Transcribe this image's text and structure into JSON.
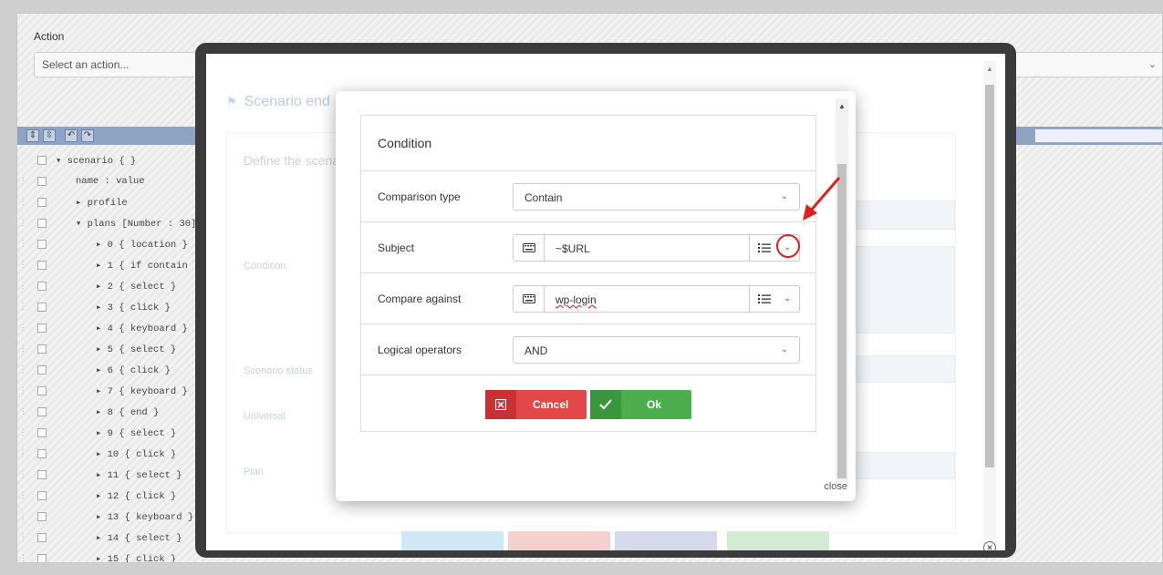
{
  "background": {
    "action_label": "Action",
    "action_placeholder": "Select an action...",
    "tree": [
      {
        "text": "▾ scenario { }",
        "indent": 0
      },
      {
        "text": "name : value",
        "indent": 1
      },
      {
        "text": "▸ profile",
        "indent": 1
      },
      {
        "text": "▾ plans [Number : 30]",
        "indent": 1
      },
      {
        "text": "▸ 0  { location }",
        "indent": 2
      },
      {
        "text": "▸ 1  { if contain",
        "indent": 2
      },
      {
        "text": "▸ 2  { select }",
        "indent": 2
      },
      {
        "text": "▸ 3  { click }",
        "indent": 2
      },
      {
        "text": "▸ 4  { keyboard }",
        "indent": 2
      },
      {
        "text": "▸ 5  { select }",
        "indent": 2
      },
      {
        "text": "▸ 6  { click }",
        "indent": 2
      },
      {
        "text": "▸ 7  { keyboard }",
        "indent": 2
      },
      {
        "text": "▸ 8  { end }",
        "indent": 2
      },
      {
        "text": "▸ 9  { select }",
        "indent": 2
      },
      {
        "text": "▸ 10 { click }",
        "indent": 2
      },
      {
        "text": "▸ 11 { select }",
        "indent": 2
      },
      {
        "text": "▸ 12 { click }",
        "indent": 2
      },
      {
        "text": "▸ 13 { keyboard }",
        "indent": 2
      },
      {
        "text": "▸ 14 { select }",
        "indent": 2
      },
      {
        "text": "▸ 15 { click }",
        "indent": 2
      }
    ]
  },
  "modal": {
    "title": "Scenario end",
    "define_title": "Define the scena",
    "labels": {
      "condition": "Condition",
      "scenario_status": "Scenario status",
      "universal": "Universal",
      "plan": "Plan"
    }
  },
  "dialog": {
    "title": "Condition",
    "rows": {
      "comparison_type": {
        "label": "Comparison type",
        "value": "Contain"
      },
      "subject": {
        "label": "Subject",
        "value": "~$URL"
      },
      "compare_against": {
        "label": "Compare against",
        "value": "wp-login"
      },
      "logical_operators": {
        "label": "Logical operators",
        "value": "AND"
      }
    },
    "cancel_label": "Cancel",
    "ok_label": "Ok",
    "close_label": "close"
  },
  "colors": {
    "cancel": "#e34848",
    "ok": "#4cae4c",
    "annotation": "#e0201e"
  }
}
